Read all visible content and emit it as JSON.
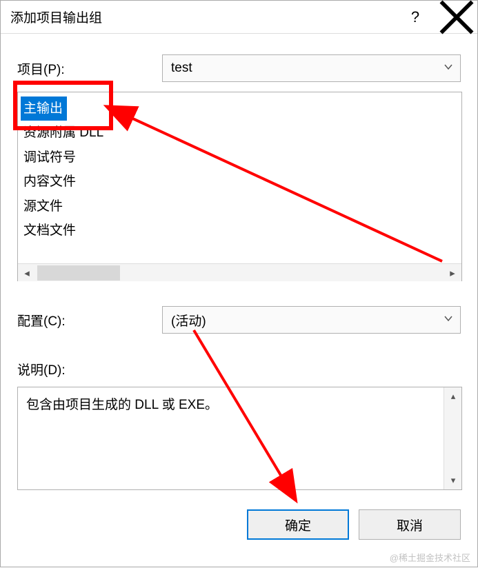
{
  "titlebar": {
    "title": "添加项目输出组"
  },
  "project": {
    "label": "项目(P):",
    "value": "test"
  },
  "list": {
    "items": [
      {
        "label": "主输出",
        "selected": true
      },
      {
        "label": "资源附属 DLL",
        "selected": false
      },
      {
        "label": "调试符号",
        "selected": false
      },
      {
        "label": "内容文件",
        "selected": false
      },
      {
        "label": "源文件",
        "selected": false
      },
      {
        "label": "文档文件",
        "selected": false
      }
    ]
  },
  "config": {
    "label": "配置(C):",
    "value": "(活动)"
  },
  "description": {
    "label": "说明(D):",
    "text": "包含由项目生成的 DLL 或 EXE。"
  },
  "buttons": {
    "ok": "确定",
    "cancel": "取消"
  },
  "watermark": "@稀土掘金技术社区"
}
